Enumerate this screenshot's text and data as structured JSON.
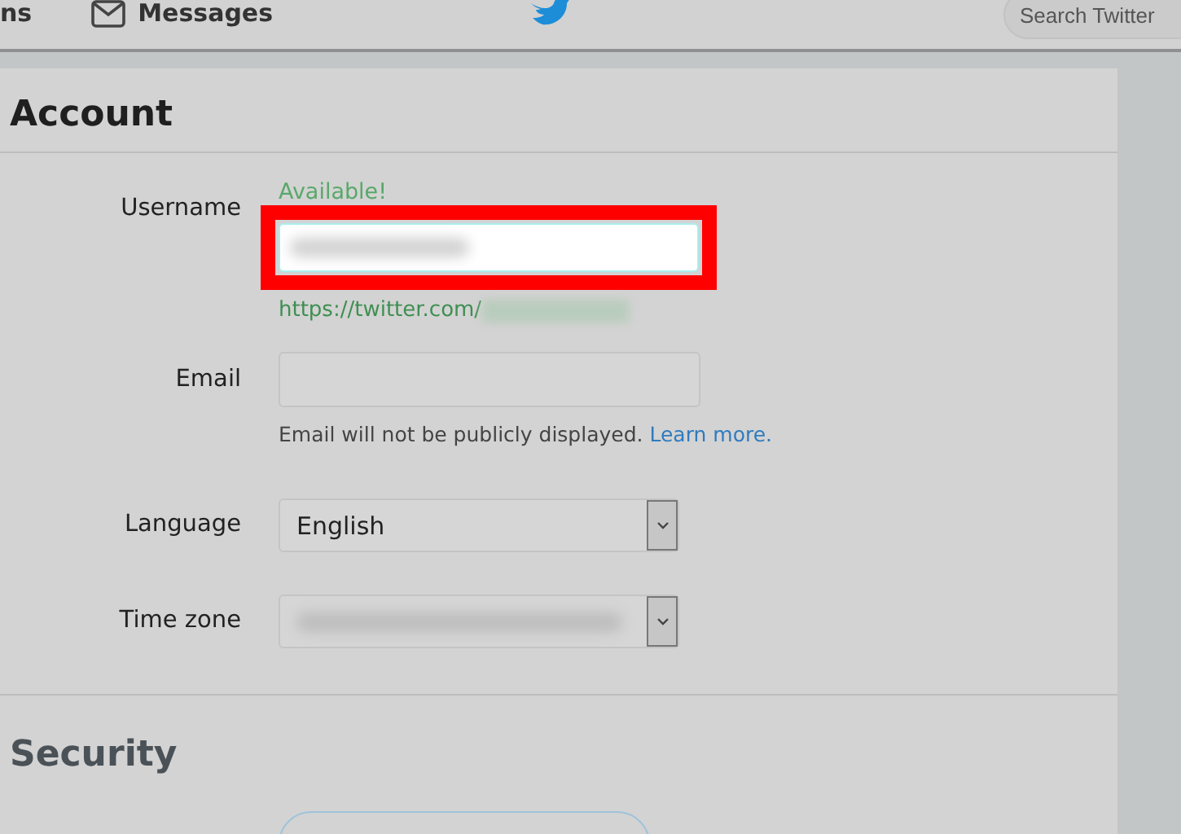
{
  "nav": {
    "items": [
      {
        "label": "ns",
        "kind": "text"
      },
      {
        "label": "Messages",
        "kind": "envelope"
      }
    ],
    "search": {
      "placeholder": "Search Twitter"
    }
  },
  "account": {
    "title": "Account",
    "username": {
      "label": "Username",
      "status": "Available!",
      "url": "https://twitter.com/",
      "highlighted": true
    },
    "email": {
      "label": "Email",
      "hint": "Email will not be publicly displayed.",
      "link": "Learn more."
    },
    "language": {
      "label": "Language",
      "value": "English"
    },
    "timezone": {
      "label": "Time zone"
    }
  },
  "security": {
    "title": "Security"
  }
}
